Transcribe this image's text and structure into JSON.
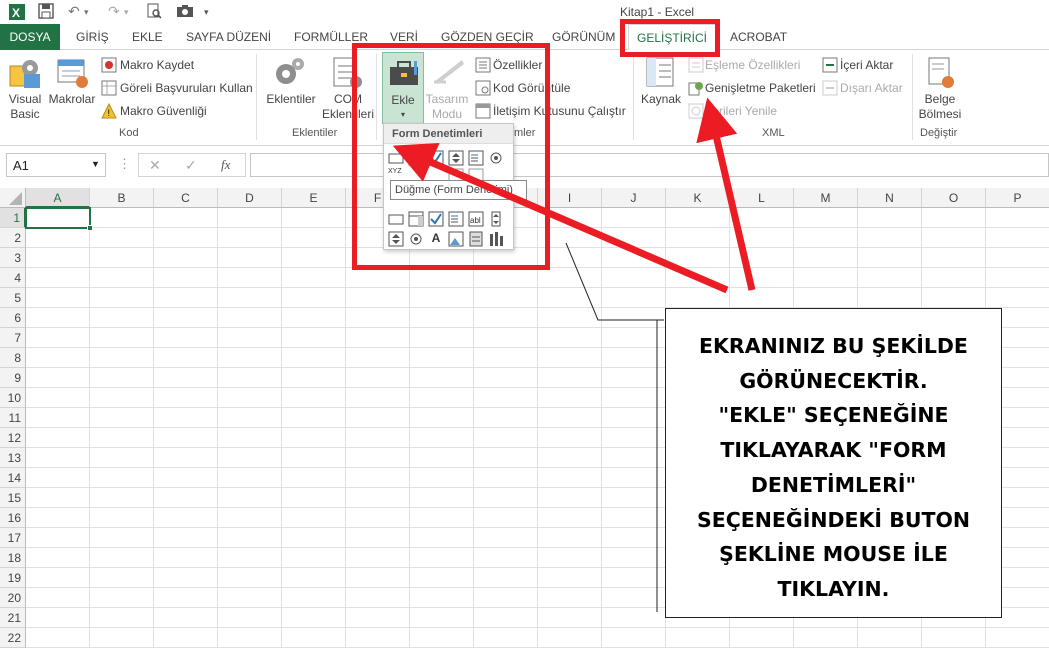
{
  "window": {
    "title": "Kitap1 - Excel"
  },
  "tabs": {
    "dosya": "DOSYA",
    "giris": "GİRİŞ",
    "ekle": "EKLE",
    "sayfa": "SAYFA DÜZENİ",
    "formuller": "FORMÜLLER",
    "veri": "VERİ",
    "gozden": "GÖZDEN GEÇİR",
    "gorunum": "GÖRÜNÜM",
    "gelistirici": "GELİŞTİRİCİ",
    "acrobat": "ACROBAT"
  },
  "ribbon": {
    "kod": {
      "visual_basic": "Visual\nBasic",
      "makrolar": "Makrolar",
      "makro_kaydet": "Makro Kaydet",
      "goreli": "Göreli Başvuruları Kullan",
      "guvenlik": "Makro Güvenliği",
      "label": "Kod"
    },
    "eklentiler": {
      "eklentiler": "Eklentiler",
      "com": "COM\nEklentileri",
      "label": "Eklentiler"
    },
    "denetimler": {
      "ekle": "Ekle",
      "tasarim": "Tasarım\nModu",
      "ozellikler": "Özellikler",
      "kod_goruntule": "Kod Görüntüle",
      "iletisim": "İletişim Kutusunu Çalıştır",
      "label": "mler"
    },
    "xml": {
      "kaynak": "Kaynak",
      "esleme": "Eşleme Özellikleri",
      "genisletme": "Genişletme Paketleri",
      "verileri_yenile": "Verileri Yenile",
      "iceri": "İçeri Aktar",
      "disari": "Dışarı Aktar",
      "label": "XML"
    },
    "degistir": {
      "belge": "Belge\nBölmesi",
      "label": "Değiştir"
    }
  },
  "formula_bar": {
    "name_box": "A1",
    "fx": "fx",
    "cancel": "✕",
    "confirm": "✓"
  },
  "dropdown": {
    "header": "Form Denetimleri",
    "tooltip": "Düğme (Form Denetimi)",
    "activex_partial": "ActiveX Denetimleri"
  },
  "columns": [
    "A",
    "B",
    "C",
    "D",
    "E",
    "F",
    "G",
    "H",
    "I",
    "J",
    "K",
    "L",
    "M",
    "N",
    "O",
    "P"
  ],
  "rows": [
    "1",
    "2",
    "3",
    "4",
    "5",
    "6",
    "7",
    "8",
    "9",
    "10",
    "11",
    "12",
    "13",
    "14",
    "15",
    "16",
    "17",
    "18",
    "19",
    "20",
    "21",
    "22"
  ],
  "annotation": {
    "lines": [
      "EKRANINIZ BU ŞEKİLDE",
      "GÖRÜNECEKTİR.",
      "\"EKLE\" SEÇENEĞİNE",
      "TIKLAYARAK \"FORM",
      "DENETİMLERİ\"",
      "SEÇENEĞİNDEKİ BUTON",
      "ŞEKLİNE MOUSE İLE",
      "TIKLAYIN."
    ]
  },
  "colors": {
    "excel_green": "#217346",
    "annotation_red": "#ec1c24"
  }
}
